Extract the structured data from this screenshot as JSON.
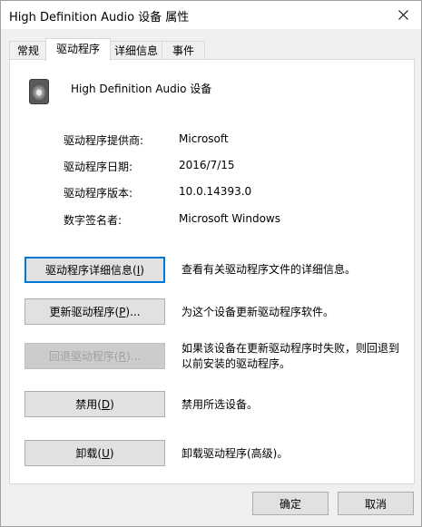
{
  "window": {
    "title": "High Definition Audio 设备 属性",
    "close_icon": "close-icon"
  },
  "tabs": [
    {
      "label": "常规"
    },
    {
      "label": "驱动程序",
      "active": true
    },
    {
      "label": "详细信息"
    },
    {
      "label": "事件"
    }
  ],
  "device": {
    "icon": "speaker-icon",
    "name": "High Definition Audio 设备"
  },
  "info": [
    {
      "label": "驱动程序提供商:",
      "value": "Microsoft"
    },
    {
      "label": "驱动程序日期:",
      "value": "2016/7/15"
    },
    {
      "label": "驱动程序版本:",
      "value": "10.0.14393.0"
    },
    {
      "label": "数字签名者:",
      "value": "Microsoft Windows"
    }
  ],
  "actions": [
    {
      "label_pre": "驱动程序详细信息(",
      "key": "I",
      "label_post": ")",
      "desc": "查看有关驱动程序文件的详细信息。",
      "enabled": true
    },
    {
      "label_pre": "更新驱动程序(",
      "key": "P",
      "label_post": ")...",
      "desc": "为这个设备更新驱动程序软件。",
      "enabled": true
    },
    {
      "label_pre": "回退驱动程序(",
      "key": "R",
      "label_post": ")...",
      "desc": "如果该设备在更新驱动程序时失败，则回退到以前安装的驱动程序。",
      "enabled": false
    },
    {
      "label_pre": "禁用(",
      "key": "D",
      "label_post": ")",
      "desc": "禁用所选设备。",
      "enabled": true
    },
    {
      "label_pre": "卸载(",
      "key": "U",
      "label_post": ")",
      "desc": "卸载驱动程序(高级)。",
      "enabled": true
    }
  ],
  "footer": {
    "ok_label": "确定",
    "cancel_label": "取消"
  },
  "colors": {
    "focus_border": "#0078d7",
    "disabled_text": "#a0a0a0"
  }
}
